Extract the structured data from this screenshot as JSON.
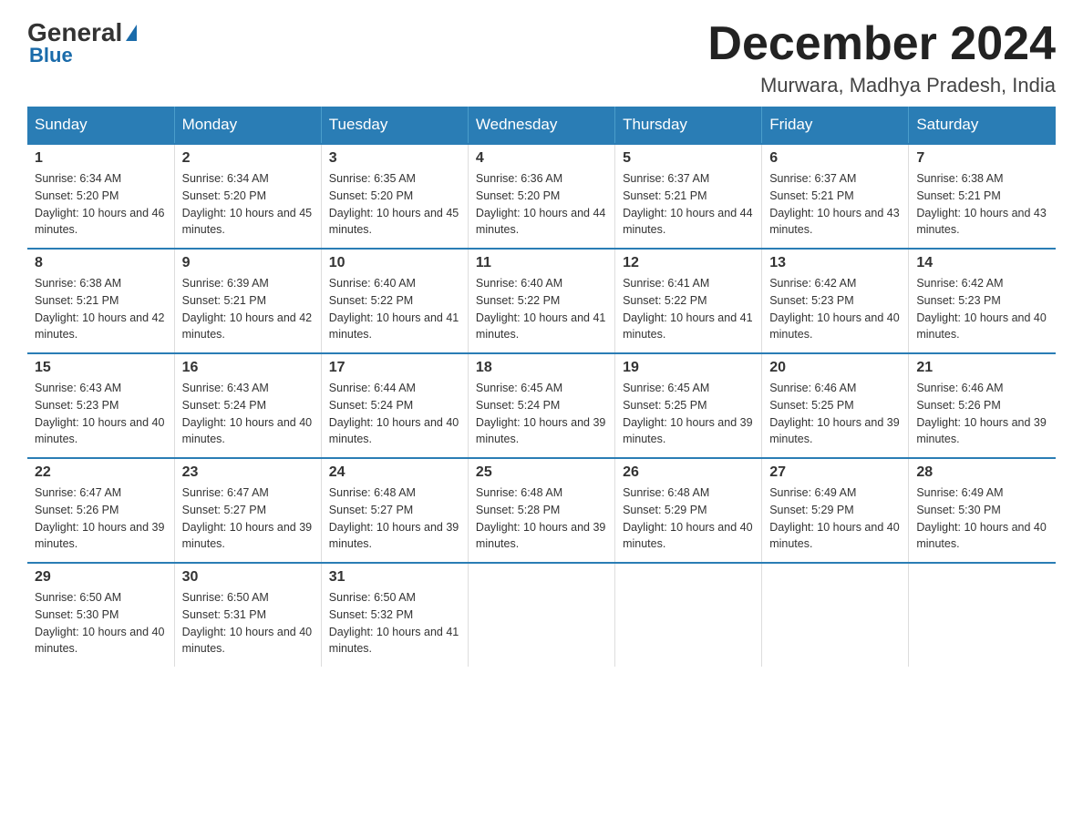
{
  "header": {
    "logo_general": "General",
    "logo_blue": "Blue",
    "month_title": "December 2024",
    "location": "Murwara, Madhya Pradesh, India"
  },
  "days_of_week": [
    "Sunday",
    "Monday",
    "Tuesday",
    "Wednesday",
    "Thursday",
    "Friday",
    "Saturday"
  ],
  "weeks": [
    [
      {
        "day": "1",
        "sunrise": "6:34 AM",
        "sunset": "5:20 PM",
        "daylight": "10 hours and 46 minutes."
      },
      {
        "day": "2",
        "sunrise": "6:34 AM",
        "sunset": "5:20 PM",
        "daylight": "10 hours and 45 minutes."
      },
      {
        "day": "3",
        "sunrise": "6:35 AM",
        "sunset": "5:20 PM",
        "daylight": "10 hours and 45 minutes."
      },
      {
        "day": "4",
        "sunrise": "6:36 AM",
        "sunset": "5:20 PM",
        "daylight": "10 hours and 44 minutes."
      },
      {
        "day": "5",
        "sunrise": "6:37 AM",
        "sunset": "5:21 PM",
        "daylight": "10 hours and 44 minutes."
      },
      {
        "day": "6",
        "sunrise": "6:37 AM",
        "sunset": "5:21 PM",
        "daylight": "10 hours and 43 minutes."
      },
      {
        "day": "7",
        "sunrise": "6:38 AM",
        "sunset": "5:21 PM",
        "daylight": "10 hours and 43 minutes."
      }
    ],
    [
      {
        "day": "8",
        "sunrise": "6:38 AM",
        "sunset": "5:21 PM",
        "daylight": "10 hours and 42 minutes."
      },
      {
        "day": "9",
        "sunrise": "6:39 AM",
        "sunset": "5:21 PM",
        "daylight": "10 hours and 42 minutes."
      },
      {
        "day": "10",
        "sunrise": "6:40 AM",
        "sunset": "5:22 PM",
        "daylight": "10 hours and 41 minutes."
      },
      {
        "day": "11",
        "sunrise": "6:40 AM",
        "sunset": "5:22 PM",
        "daylight": "10 hours and 41 minutes."
      },
      {
        "day": "12",
        "sunrise": "6:41 AM",
        "sunset": "5:22 PM",
        "daylight": "10 hours and 41 minutes."
      },
      {
        "day": "13",
        "sunrise": "6:42 AM",
        "sunset": "5:23 PM",
        "daylight": "10 hours and 40 minutes."
      },
      {
        "day": "14",
        "sunrise": "6:42 AM",
        "sunset": "5:23 PM",
        "daylight": "10 hours and 40 minutes."
      }
    ],
    [
      {
        "day": "15",
        "sunrise": "6:43 AM",
        "sunset": "5:23 PM",
        "daylight": "10 hours and 40 minutes."
      },
      {
        "day": "16",
        "sunrise": "6:43 AM",
        "sunset": "5:24 PM",
        "daylight": "10 hours and 40 minutes."
      },
      {
        "day": "17",
        "sunrise": "6:44 AM",
        "sunset": "5:24 PM",
        "daylight": "10 hours and 40 minutes."
      },
      {
        "day": "18",
        "sunrise": "6:45 AM",
        "sunset": "5:24 PM",
        "daylight": "10 hours and 39 minutes."
      },
      {
        "day": "19",
        "sunrise": "6:45 AM",
        "sunset": "5:25 PM",
        "daylight": "10 hours and 39 minutes."
      },
      {
        "day": "20",
        "sunrise": "6:46 AM",
        "sunset": "5:25 PM",
        "daylight": "10 hours and 39 minutes."
      },
      {
        "day": "21",
        "sunrise": "6:46 AM",
        "sunset": "5:26 PM",
        "daylight": "10 hours and 39 minutes."
      }
    ],
    [
      {
        "day": "22",
        "sunrise": "6:47 AM",
        "sunset": "5:26 PM",
        "daylight": "10 hours and 39 minutes."
      },
      {
        "day": "23",
        "sunrise": "6:47 AM",
        "sunset": "5:27 PM",
        "daylight": "10 hours and 39 minutes."
      },
      {
        "day": "24",
        "sunrise": "6:48 AM",
        "sunset": "5:27 PM",
        "daylight": "10 hours and 39 minutes."
      },
      {
        "day": "25",
        "sunrise": "6:48 AM",
        "sunset": "5:28 PM",
        "daylight": "10 hours and 39 minutes."
      },
      {
        "day": "26",
        "sunrise": "6:48 AM",
        "sunset": "5:29 PM",
        "daylight": "10 hours and 40 minutes."
      },
      {
        "day": "27",
        "sunrise": "6:49 AM",
        "sunset": "5:29 PM",
        "daylight": "10 hours and 40 minutes."
      },
      {
        "day": "28",
        "sunrise": "6:49 AM",
        "sunset": "5:30 PM",
        "daylight": "10 hours and 40 minutes."
      }
    ],
    [
      {
        "day": "29",
        "sunrise": "6:50 AM",
        "sunset": "5:30 PM",
        "daylight": "10 hours and 40 minutes."
      },
      {
        "day": "30",
        "sunrise": "6:50 AM",
        "sunset": "5:31 PM",
        "daylight": "10 hours and 40 minutes."
      },
      {
        "day": "31",
        "sunrise": "6:50 AM",
        "sunset": "5:32 PM",
        "daylight": "10 hours and 41 minutes."
      },
      null,
      null,
      null,
      null
    ]
  ],
  "labels": {
    "sunrise": "Sunrise:",
    "sunset": "Sunset:",
    "daylight": "Daylight:"
  }
}
